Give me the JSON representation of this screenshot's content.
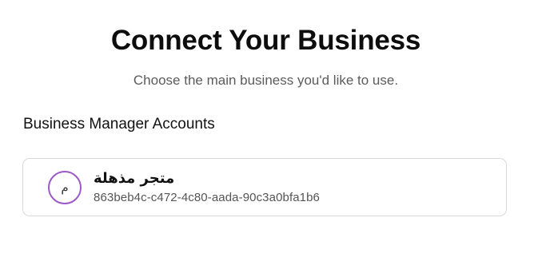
{
  "header": {
    "title": "Connect Your Business",
    "subtitle": "Choose the main business you'd like to use."
  },
  "section": {
    "heading": "Business Manager Accounts"
  },
  "accounts": [
    {
      "avatar_initial": "م",
      "name": "متجر مذهلة",
      "id": "863beb4c-c472-4c80-aada-90c3a0bfa1b6"
    }
  ],
  "colors": {
    "avatar_border": "#9b59c9",
    "card_border": "#d9d9d9",
    "subtitle_text": "#5b5b5b"
  }
}
